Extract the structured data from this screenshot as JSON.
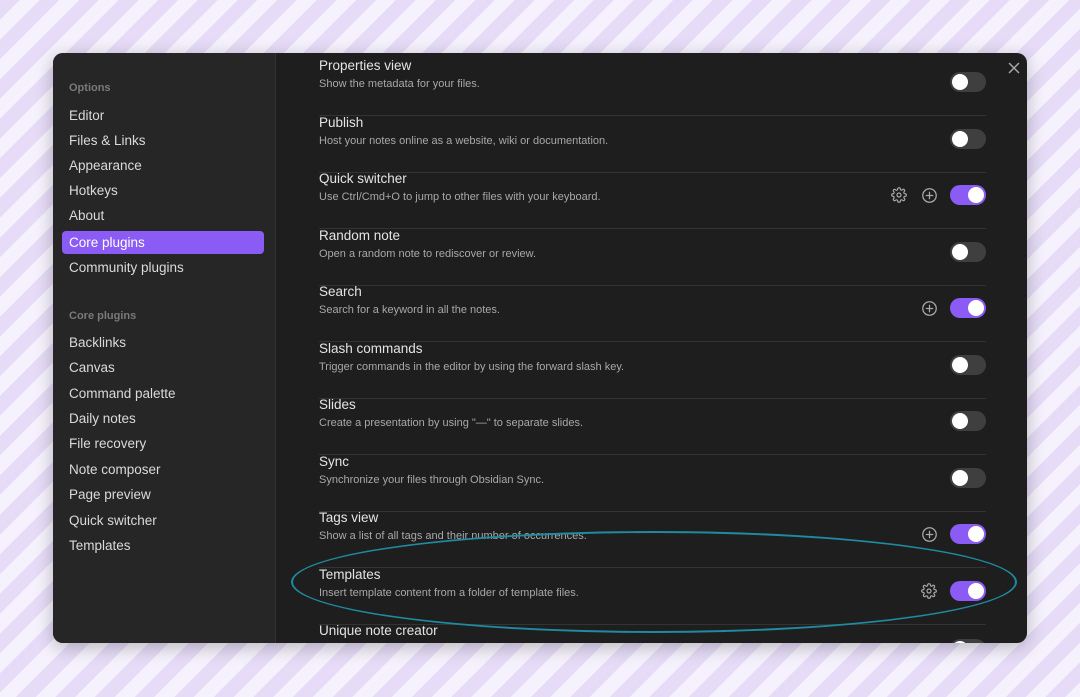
{
  "sidebar": {
    "options_heading": "Options",
    "options_items": [
      {
        "label": "Editor"
      },
      {
        "label": "Files & Links"
      },
      {
        "label": "Appearance"
      },
      {
        "label": "Hotkeys"
      },
      {
        "label": "About"
      },
      {
        "label": "Core plugins",
        "active": true
      },
      {
        "label": "Community plugins"
      }
    ],
    "core_heading": "Core plugins",
    "core_items": [
      {
        "label": "Backlinks"
      },
      {
        "label": "Canvas"
      },
      {
        "label": "Command palette"
      },
      {
        "label": "Daily notes"
      },
      {
        "label": "File recovery"
      },
      {
        "label": "Note composer"
      },
      {
        "label": "Page preview"
      },
      {
        "label": "Quick switcher"
      },
      {
        "label": "Templates"
      }
    ]
  },
  "plugins": [
    {
      "title": "Properties view",
      "desc": "Show the metadata for your files.",
      "enabled": false,
      "settings": false,
      "hotkey": false
    },
    {
      "title": "Publish",
      "desc": "Host your notes online as a website, wiki or documentation.",
      "enabled": false,
      "settings": false,
      "hotkey": false
    },
    {
      "title": "Quick switcher",
      "desc": "Use Ctrl/Cmd+O to jump to other files with your keyboard.",
      "enabled": true,
      "settings": true,
      "hotkey": true
    },
    {
      "title": "Random note",
      "desc": "Open a random note to rediscover or review.",
      "enabled": false,
      "settings": false,
      "hotkey": false
    },
    {
      "title": "Search",
      "desc": "Search for a keyword in all the notes.",
      "enabled": true,
      "settings": false,
      "hotkey": true
    },
    {
      "title": "Slash commands",
      "desc": "Trigger commands in the editor by using the forward slash key.",
      "enabled": false,
      "settings": false,
      "hotkey": false
    },
    {
      "title": "Slides",
      "desc": "Create a presentation by using \"—\" to separate slides.",
      "enabled": false,
      "settings": false,
      "hotkey": false
    },
    {
      "title": "Sync",
      "desc": "Synchronize your files through Obsidian Sync.",
      "enabled": false,
      "settings": false,
      "hotkey": false
    },
    {
      "title": "Tags view",
      "desc": "Show a list of all tags and their number of occurrences.",
      "enabled": true,
      "settings": false,
      "hotkey": true
    },
    {
      "title": "Templates",
      "desc": "Insert template content from a folder of template files.",
      "enabled": true,
      "settings": true,
      "hotkey": false
    },
    {
      "title": "Unique note creator",
      "desc": "",
      "enabled": false,
      "settings": false,
      "hotkey": false
    }
  ],
  "colors": {
    "accent": "#8a5cf5",
    "modal_bg": "#1e1e1e",
    "sidebar_bg": "#262626",
    "highlight_ring": "#1f8aa0"
  },
  "icons": {
    "close": "close-icon",
    "settings": "gear-icon",
    "hotkey": "plus-circle-icon"
  }
}
